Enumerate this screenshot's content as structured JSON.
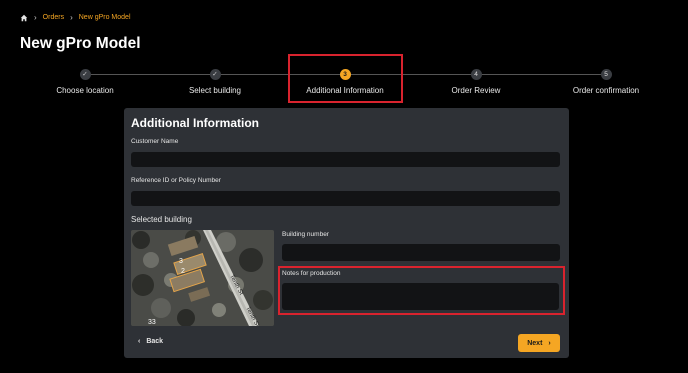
{
  "breadcrumb": {
    "home_icon": "home-icon",
    "items": [
      "Orders",
      "New gPro Model"
    ],
    "separator": ">"
  },
  "page": {
    "title": "New gPro Model"
  },
  "stepper": {
    "steps": [
      {
        "label": "Choose location",
        "state": "done",
        "marker": "✓"
      },
      {
        "label": "Select building",
        "state": "done",
        "marker": "✓"
      },
      {
        "label": "Additional Information",
        "state": "active",
        "marker": "3"
      },
      {
        "label": "Order Review",
        "state": "todo",
        "marker": "4"
      },
      {
        "label": "Order confirmation",
        "state": "todo",
        "marker": "5"
      }
    ]
  },
  "form": {
    "title": "Additional Information",
    "customer_name_label": "Customer Name",
    "customer_name_value": "",
    "reference_label": "Reference ID or Policy Number",
    "reference_value": "",
    "selected_building_label": "Selected building",
    "building_number_label": "Building number",
    "building_number_value": "",
    "notes_label": "Notes for production",
    "notes_value": "",
    "map": {
      "labels": [
        "3",
        "2",
        "33"
      ],
      "streets": [
        "Tenth St",
        "Tenth St"
      ]
    },
    "back_label": "Back",
    "next_label": "Next"
  },
  "colors": {
    "accent": "#f5a623",
    "highlight": "#d9232e",
    "panel": "#2e3136",
    "field": "#121315"
  }
}
